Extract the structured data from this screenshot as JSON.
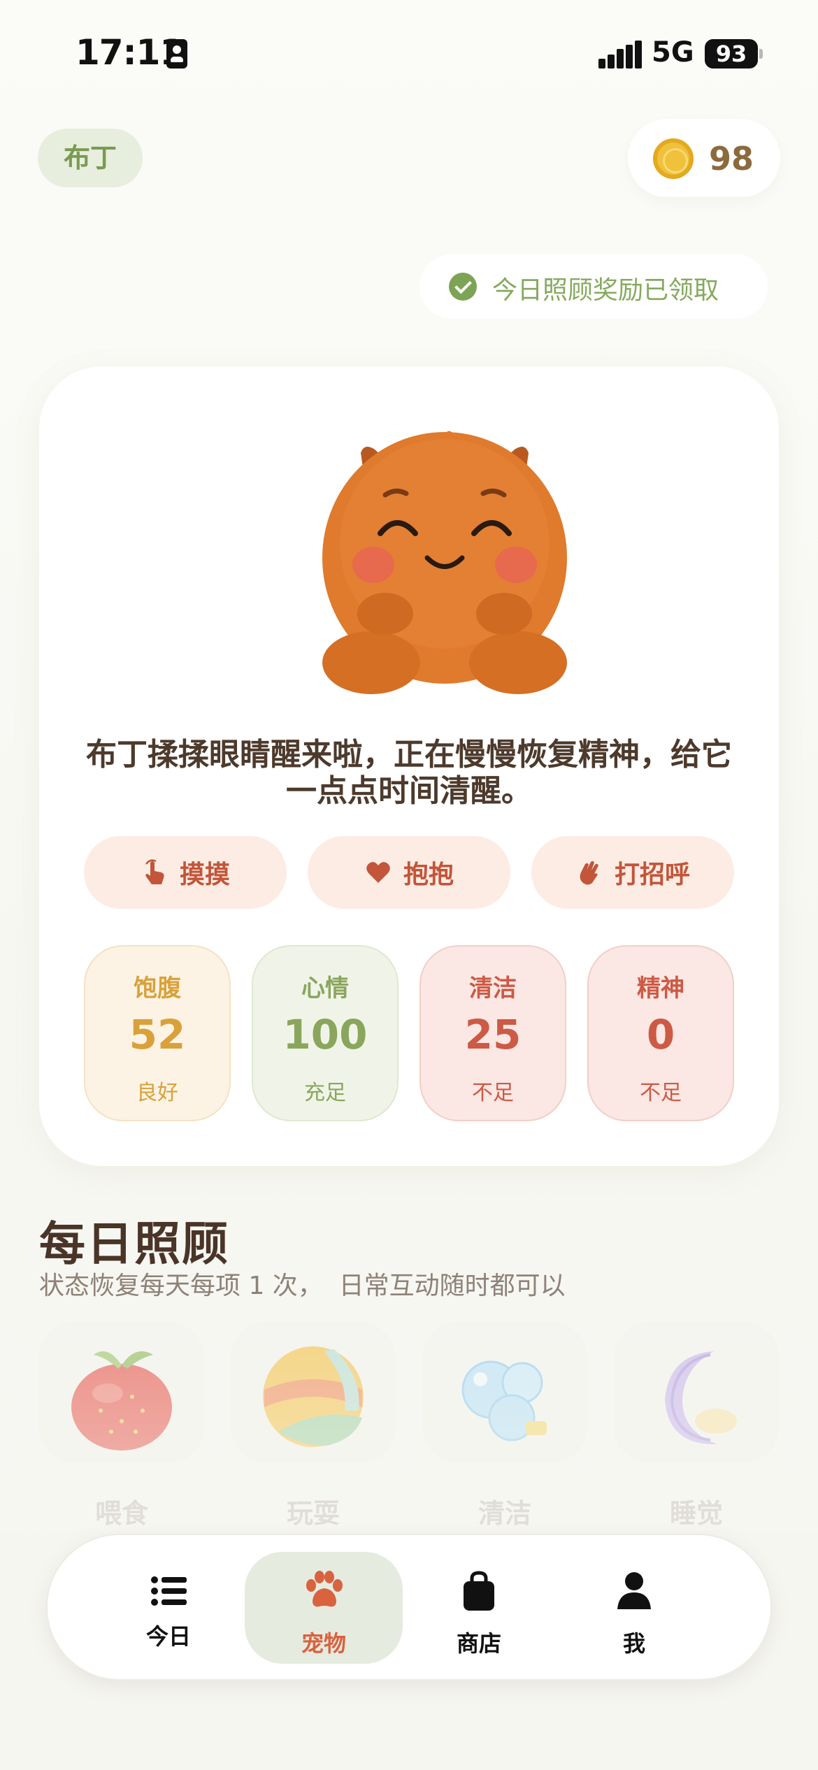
{
  "status_bar": {
    "time": "17:11",
    "network": "5G",
    "battery": "93"
  },
  "header": {
    "pet_name": "布丁",
    "coins": "98"
  },
  "reward_notice": "今日照顾奖励已领取",
  "pet_card": {
    "message": "布丁揉揉眼睛醒来啦，正在慢慢恢复精神，给它一点点时间清醒。",
    "actions": [
      {
        "label": "摸摸",
        "icon": "tap-hand-icon"
      },
      {
        "label": "抱抱",
        "icon": "heart-icon"
      },
      {
        "label": "打招呼",
        "icon": "wave-hand-icon"
      }
    ],
    "stats": [
      {
        "label": "饱腹",
        "value": "52",
        "status": "良好",
        "color": "#d9a13a"
      },
      {
        "label": "心情",
        "value": "100",
        "status": "充足",
        "color": "#8aa65d"
      },
      {
        "label": "清洁",
        "value": "25",
        "status": "不足",
        "color": "#cc5a45"
      },
      {
        "label": "精神",
        "value": "0",
        "status": "不足",
        "color": "#cc5a45"
      }
    ]
  },
  "daily_care": {
    "title": "每日照顾",
    "subtitle": "状态恢复每天每项 1 次，  日常互动随时都可以",
    "items": [
      {
        "label": "喂食",
        "icon": "strawberry-icon"
      },
      {
        "label": "玩耍",
        "icon": "ball-icon"
      },
      {
        "label": "清洁",
        "icon": "bubbles-icon"
      },
      {
        "label": "睡觉",
        "icon": "moon-icon"
      }
    ]
  },
  "tabs": [
    {
      "label": "今日",
      "icon": "list-icon",
      "active": false
    },
    {
      "label": "宠物",
      "icon": "paw-icon",
      "active": true
    },
    {
      "label": "商店",
      "icon": "bag-icon",
      "active": false
    },
    {
      "label": "我",
      "icon": "person-icon",
      "active": false
    }
  ],
  "colors": {
    "accent": "#d9623f",
    "green": "#86a95e",
    "card_bg": "#ffffff"
  }
}
